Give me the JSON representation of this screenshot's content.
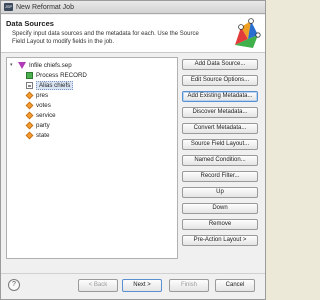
{
  "window": {
    "title": "New Reformat Job",
    "app_icon_text": "JSP"
  },
  "header": {
    "title": "Data Sources",
    "description": "Specify input data sources and the metadata for each. Use the Source Field Layout to modify fields in the job."
  },
  "tree": {
    "items": [
      {
        "label": "Infile chiefs.sep",
        "kind": "file",
        "expanded": true
      },
      {
        "label": "Process RECORD",
        "kind": "process"
      },
      {
        "label": "Alias chiefs",
        "kind": "alias",
        "selected": true
      },
      {
        "label": "pres",
        "kind": "field"
      },
      {
        "label": "votes",
        "kind": "field"
      },
      {
        "label": "service",
        "kind": "field"
      },
      {
        "label": "party",
        "kind": "field"
      },
      {
        "label": "state",
        "kind": "field"
      }
    ]
  },
  "buttons": {
    "add_data_source": "Add Data Source...",
    "edit_source_options": "Edit Source Options...",
    "add_existing_metadata": "Add Existing Metadata...",
    "discover_metadata": "Discover Metadata...",
    "convert_metadata": "Convert Metadata...",
    "source_field_layout": "Source Field Layout...",
    "named_condition": "Named Condition...",
    "record_filter": "Record Filter...",
    "up": "Up",
    "down": "Down",
    "remove": "Remove",
    "pre_action_layout": "Pre-Action Layout >"
  },
  "footer": {
    "help": "?",
    "back": "< Back",
    "next": "Next >",
    "finish": "Finish",
    "cancel": "Cancel"
  }
}
